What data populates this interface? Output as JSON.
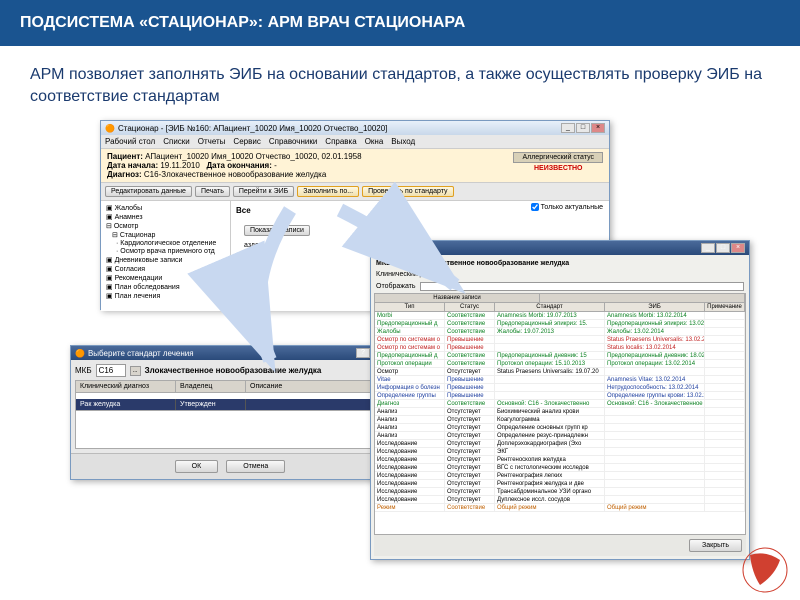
{
  "header": "ПОДСИСТЕМА «СТАЦИОНАР»: АРМ ВРАЧ СТАЦИОНАРА",
  "description": "АРМ позволяет заполнять ЭИБ на основании стандартов, а также осуществлять проверку ЭИБ на соответствие стандартам",
  "main_window": {
    "title": "Стационар - [ЭИБ №160: АПациент_10020 Имя_10020 Отчество_10020]",
    "menu": [
      "Рабочий стол",
      "Списки",
      "Отчеты",
      "Сервис",
      "Справочники",
      "Справка",
      "Окна",
      "Выход"
    ],
    "patient_label": "Пациент:",
    "patient": "АПациент_10020 Имя_10020 Отчество_10020, 02.01.1958",
    "date_start_label": "Дата начала:",
    "date_start": "19.11.2010",
    "date_end_label": "Дата окончания:",
    "date_end": "-",
    "diagnosis_label": "Диагноз:",
    "diagnosis": "С16-Злокачественное новообразование желудка",
    "allerg_label": "Аллергический статус",
    "allerg_status": "НЕИЗВЕСТНО",
    "actions": {
      "edit": "Редактировать данные",
      "print": "Печать",
      "goto": "Перейти к ЭИБ",
      "fill": "Заполнить по...",
      "check": "Проверить по стандарту"
    },
    "all_label": "Все",
    "only_actual": "Только актуальные",
    "show_btn": "Показать записи",
    "razdel": "аздел",
    "tree": [
      "Жалобы",
      "Анамнез",
      "Осмотр",
      "Стационар",
      "Кардиологическое отделение",
      "Осмотр врача приемного отд",
      "Дневниковые записи",
      "Согласия",
      "Рекомендации",
      "План обследования",
      "План лечения"
    ]
  },
  "dialog": {
    "title": "Выберите стандарт лечения",
    "mkb_label": "МКБ",
    "mkb_code": "С16",
    "mkb_name": "Злокачественное новообразование желудка",
    "headers": [
      "Клинический диагноз",
      "Владелец",
      "Описание"
    ],
    "row": [
      "Рак желудка",
      "Утвержден",
      ""
    ],
    "ok": "ОК",
    "cancel": "Отмена"
  },
  "check": {
    "title": "Проверка по",
    "mkb_line": "МКБ: С16 - Злокачественное новообразование желудка",
    "diag_line": "Клинический диагноз",
    "show_label": "Отображать",
    "group1": "Название записи",
    "headers": [
      "Тип",
      "Статус",
      "Стандарт",
      "ЭИБ",
      "Примечание"
    ],
    "close_btn": "Закрыть",
    "rows": [
      {
        "c": "green",
        "t": "Morbi",
        "s": "Соответствие",
        "std": "Anamnesis Morbi: 19.07.2013",
        "eib": "Anamnesis Morbi: 13.02.2014"
      },
      {
        "c": "green",
        "t": "Предоперационный д",
        "s": "Соответствие",
        "std": "Предоперационный эпикриз: 15.",
        "eib": "Предоперационный эпикриз: 13.02.2014"
      },
      {
        "c": "green",
        "t": "Жалобы",
        "s": "Соответствие",
        "std": "Жалобы: 19.07.2013",
        "eib": "Жалобы: 13.02.2014"
      },
      {
        "c": "red",
        "t": "Осмотр по системам о",
        "s": "Превышение",
        "std": "",
        "eib": "Status Praesens Universalis: 13.02.201"
      },
      {
        "c": "red",
        "t": "Осмотр по системам о",
        "s": "Превышение",
        "std": "",
        "eib": "Status localis: 13.02.2014"
      },
      {
        "c": "green",
        "t": "Предоперационный д",
        "s": "Соответствие",
        "std": "Предоперационный дневник: 15",
        "eib": "Предоперационный дневник: 18.02."
      },
      {
        "c": "green",
        "t": "Протокол операции",
        "s": "Соответствие",
        "std": "Протокол операции: 15.10.2013",
        "eib": "Протокол операции: 13.02.2014"
      },
      {
        "c": "",
        "t": "Осмотр",
        "s": "Отсутствует",
        "std": "Status Praesens Universalis: 19.07.20",
        "eib": ""
      },
      {
        "c": "blue",
        "t": "Vitae",
        "s": "Превышение",
        "std": "",
        "eib": "Anamnesis Vitae: 13.02.2014"
      },
      {
        "c": "blue",
        "t": "Информация о болезн",
        "s": "Превышение",
        "std": "",
        "eib": "Нетрудоспособность: 13.02.2014"
      },
      {
        "c": "blue",
        "t": "Определение группы",
        "s": "Превышение",
        "std": "",
        "eib": "Определение группы крови: 13.02.2014"
      },
      {
        "c": "green",
        "t": "Диагноз",
        "s": "Соответствие",
        "std": "Основной: С16 - Злокачественно",
        "eib": "Основной: С16 - Злокачественное но"
      },
      {
        "c": "",
        "t": "Анализ",
        "s": "Отсутствует",
        "std": "Биохимический анализ крови",
        "eib": ""
      },
      {
        "c": "",
        "t": "Анализ",
        "s": "Отсутствует",
        "std": "Коагулограмма",
        "eib": ""
      },
      {
        "c": "",
        "t": "Анализ",
        "s": "Отсутствует",
        "std": "Определение основных групп кр",
        "eib": ""
      },
      {
        "c": "",
        "t": "Анализ",
        "s": "Отсутствует",
        "std": "Определение резус-принадлежн",
        "eib": ""
      },
      {
        "c": "",
        "t": "Исследование",
        "s": "Отсутствует",
        "std": "Доплерэхокардиография (Эхо",
        "eib": ""
      },
      {
        "c": "",
        "t": "Исследование",
        "s": "Отсутствует",
        "std": "ЭКГ",
        "eib": ""
      },
      {
        "c": "",
        "t": "Исследование",
        "s": "Отсутствует",
        "std": "Рентгеноскопия желудка",
        "eib": ""
      },
      {
        "c": "",
        "t": "Исследование",
        "s": "Отсутствует",
        "std": "ВГС с гистологическим исследов",
        "eib": ""
      },
      {
        "c": "",
        "t": "Исследование",
        "s": "Отсутствует",
        "std": "Рентгенография легких",
        "eib": ""
      },
      {
        "c": "",
        "t": "Исследование",
        "s": "Отсутствует",
        "std": "Рентгенография желудка и две",
        "eib": ""
      },
      {
        "c": "",
        "t": "Исследование",
        "s": "Отсутствует",
        "std": "Трансабдоминальное УЗИ органо",
        "eib": ""
      },
      {
        "c": "",
        "t": "Исследование",
        "s": "Отсутствует",
        "std": "Дуплексное иссл. сосудов",
        "eib": ""
      },
      {
        "c": "orange",
        "t": "Режим",
        "s": "Соответствие",
        "std": "Общий режим",
        "eib": "Общий режим"
      }
    ]
  }
}
